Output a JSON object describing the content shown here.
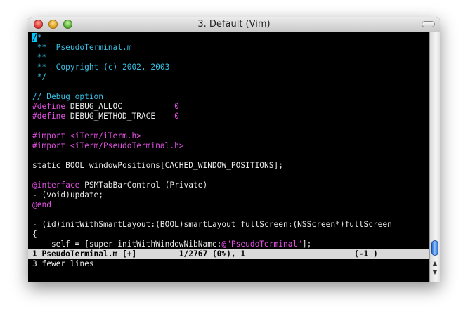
{
  "window": {
    "title": "3. Default (Vim)"
  },
  "editor": {
    "cursor_char": "/",
    "lines": [
      [
        {
          "t": "*",
          "c": "c-comment"
        }
      ],
      [
        {
          "t": " **  PseudoTerminal.m",
          "c": "c-comment"
        }
      ],
      [
        {
          "t": " **",
          "c": "c-comment"
        }
      ],
      [
        {
          "t": " **  Copyright (c) 2002, 2003",
          "c": "c-comment"
        }
      ],
      [
        {
          "t": " */",
          "c": "c-comment"
        }
      ],
      [],
      [
        {
          "t": "// Debug option",
          "c": "c-comment"
        }
      ],
      [
        {
          "t": "#define",
          "c": "c-pre"
        },
        {
          "t": " DEBUG_ALLOC           ",
          "c": "c-text"
        },
        {
          "t": "0",
          "c": "c-num"
        }
      ],
      [
        {
          "t": "#define",
          "c": "c-pre"
        },
        {
          "t": " DEBUG_METHOD_TRACE    ",
          "c": "c-text"
        },
        {
          "t": "0",
          "c": "c-num"
        }
      ],
      [],
      [
        {
          "t": "#import",
          "c": "c-pre"
        },
        {
          "t": " ",
          "c": "c-text"
        },
        {
          "t": "<iTerm/iTerm.h>",
          "c": "c-str"
        }
      ],
      [
        {
          "t": "#import",
          "c": "c-pre"
        },
        {
          "t": " ",
          "c": "c-text"
        },
        {
          "t": "<iTerm/PseudoTerminal.h>",
          "c": "c-str"
        }
      ],
      [],
      [
        {
          "t": "static BOOL windowPositions[CACHED_WINDOW_POSITIONS];",
          "c": "c-text"
        }
      ],
      [],
      [
        {
          "t": "@interface",
          "c": "c-pre"
        },
        {
          "t": " PSMTabBarControl (Private)",
          "c": "c-text"
        }
      ],
      [
        {
          "t": "- (void)update;",
          "c": "c-text"
        }
      ],
      [
        {
          "t": "@end",
          "c": "c-pre"
        }
      ],
      [],
      [
        {
          "t": "- (id)initWithSmartLayout:(BOOL)smartLayout fullScreen:(NSScreen*)fullScreen",
          "c": "c-text"
        }
      ],
      [
        {
          "t": "{",
          "c": "c-text"
        }
      ],
      [
        {
          "t": "    self = [super initWithWindowNibName:",
          "c": "c-text"
        },
        {
          "t": "@\"PseudoTerminal\"",
          "c": "c-str"
        },
        {
          "t": "];",
          "c": "c-text"
        }
      ]
    ],
    "status_line": "1 PseudoTerminal.m [+]         1/2767 (0%), 1                       (-1 )",
    "message_line": "3 fewer lines"
  },
  "scrollbar": {
    "position_fraction": 0.0,
    "up_arrow": "▲",
    "down_arrow": "▼"
  }
}
